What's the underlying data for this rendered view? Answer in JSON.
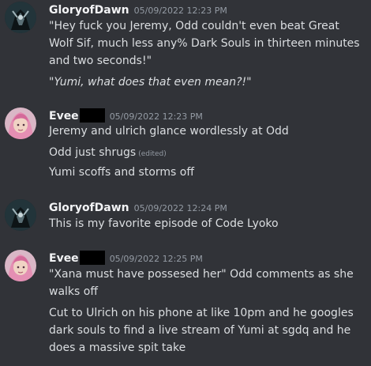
{
  "messages": [
    {
      "username": "GloryofDawn",
      "timestamp": "05/09/2022 12:23 PM",
      "avatar": "dark-knight-avatar",
      "lines": [
        "\"Hey fuck you Jeremy, Odd couldn't even beat Great Wolf Sif, much less any% Dark Souls in thirteen minutes and two seconds!\"",
        "\"Yumi, what does that even mean?!\""
      ]
    },
    {
      "username": "Evee",
      "timestamp": "05/09/2022 12:23 PM",
      "avatar": "pink-hair-avatar",
      "lines": [
        "Jeremy and ulrich glance wordlessly at Odd",
        "Odd just shrugs",
        "Yumi scoffs and storms off"
      ],
      "edited_label": "(edited)"
    },
    {
      "username": "GloryofDawn",
      "timestamp": "05/09/2022 12:24 PM",
      "avatar": "dark-knight-avatar",
      "lines": [
        "This is my favorite episode of Code Lyoko"
      ]
    },
    {
      "username": "Evee",
      "timestamp": "05/09/2022 12:25 PM",
      "avatar": "pink-hair-avatar",
      "lines": [
        "\"Xana must have possesed her\" Odd comments as she walks off",
        "Cut to Ulrich on his phone at like 10pm and he googles dark souls to find a live stream of Yumi at sgdq and he does a massive spit take"
      ]
    }
  ],
  "colors": {
    "background": "#313338",
    "username": "#f2f3f5",
    "text": "#dbdee1",
    "muted": "#949ba4"
  }
}
